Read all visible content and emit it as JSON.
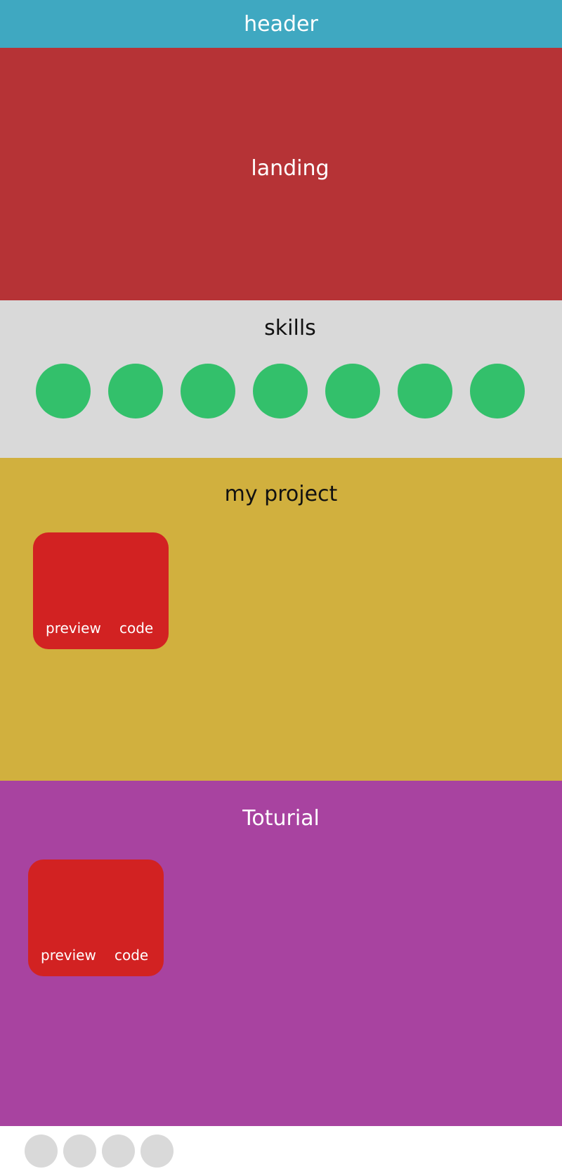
{
  "header": {
    "title": "header"
  },
  "landing": {
    "title": "landing"
  },
  "skills": {
    "title": "skills",
    "items": [
      {
        "icon": "skill-icon",
        "color": "#33c06b"
      },
      {
        "icon": "skill-icon",
        "color": "#33c06b"
      },
      {
        "icon": "skill-icon",
        "color": "#33c06b"
      },
      {
        "icon": "skill-icon",
        "color": "#33c06b"
      },
      {
        "icon": "skill-icon",
        "color": "#33c06b"
      },
      {
        "icon": "skill-icon",
        "color": "#33c06b"
      },
      {
        "icon": "skill-icon",
        "color": "#33c06b"
      }
    ]
  },
  "projects": {
    "title": "my project",
    "cards": [
      {
        "preview_label": "preview",
        "code_label": "code"
      }
    ]
  },
  "tutorials": {
    "title": "Toturial",
    "cards": [
      {
        "preview_label": "preview",
        "code_label": "code"
      }
    ]
  },
  "footer": {
    "links": [
      {
        "icon": "social-icon"
      },
      {
        "icon": "social-icon"
      },
      {
        "icon": "social-icon"
      },
      {
        "icon": "social-icon"
      }
    ]
  },
  "colors": {
    "header": "#3fa8c1",
    "landing": "#b63336",
    "skills_bg": "#d9d9d9",
    "skill_circle": "#33c06b",
    "projects_bg": "#d1b03e",
    "tutorials_bg": "#a843a0",
    "card": "#d22222",
    "footer_dot": "#d9d9d9"
  }
}
